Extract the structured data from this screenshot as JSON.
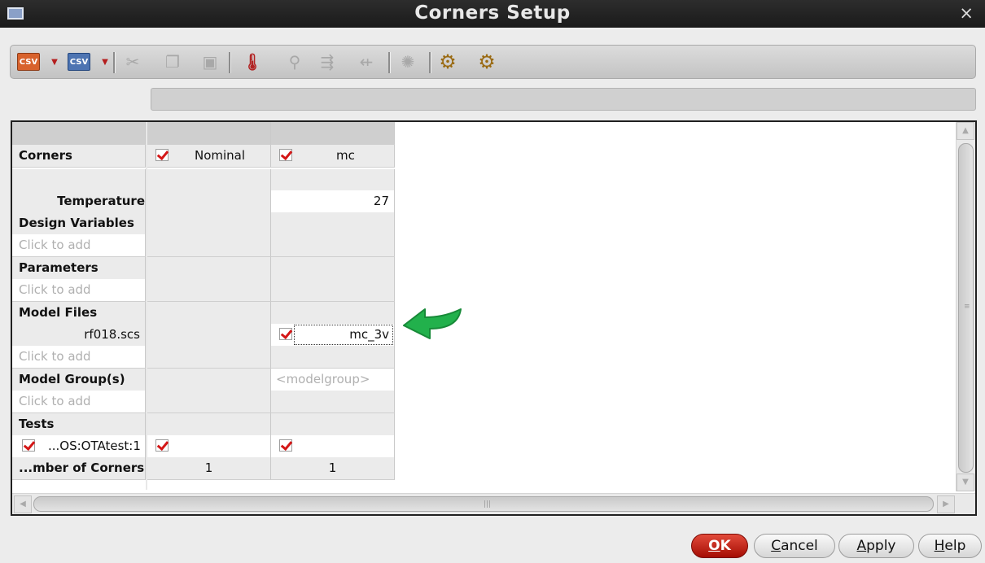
{
  "window": {
    "title": "Corners Setup",
    "close_glyph": "×"
  },
  "toolbar": {
    "csv_label": "CSV",
    "dropdown_glyph": "▼",
    "icons": [
      "open-csv-icon",
      "save-csv-icon",
      "cut-icon",
      "copy-icon",
      "paste-icon",
      "add-temperature-icon",
      "add-parameter-icon",
      "load-parameters-icon",
      "save-parameters-icon",
      "monte-carlo-icon",
      "setup-icon",
      "copy-setup-icon"
    ]
  },
  "table": {
    "corners_label": "Corners",
    "columns": [
      {
        "name": "Nominal",
        "checked": true
      },
      {
        "name": "mc",
        "checked": true
      }
    ],
    "rows": {
      "temperature": {
        "label": "Temperature",
        "nominal": "",
        "mc": "27"
      },
      "design_variables": {
        "label": "Design Variables"
      },
      "dv_add": "Click to add",
      "parameters": {
        "label": "Parameters"
      },
      "param_add": "Click to add",
      "model_files": {
        "label": "Model Files"
      },
      "model_file_1": {
        "label": "rf018.scs",
        "mc_checked": true,
        "mc_value": "mc_3v"
      },
      "mf_add": "Click to add",
      "model_groups": {
        "label": "Model Group(s)",
        "mc_placeholder": "<modelgroup>"
      },
      "mg_add": "Click to add",
      "tests": {
        "label": "Tests"
      },
      "test_1": {
        "label": "...OS:OTAtest:1",
        "checked": true
      },
      "num_corners": {
        "label": "...mber of Corners",
        "nominal": "1",
        "mc": "1"
      }
    }
  },
  "buttons": {
    "ok": {
      "key": "O",
      "rest": "K"
    },
    "cancel": {
      "key": "C",
      "rest": "ancel"
    },
    "apply": {
      "key": "A",
      "rest": "pply"
    },
    "help": {
      "key": "H",
      "rest": "elp"
    }
  },
  "colors": {
    "accent_check": "#d41717",
    "annotation_arrow": "#22b14c",
    "ok_button": "#c41a0c"
  }
}
